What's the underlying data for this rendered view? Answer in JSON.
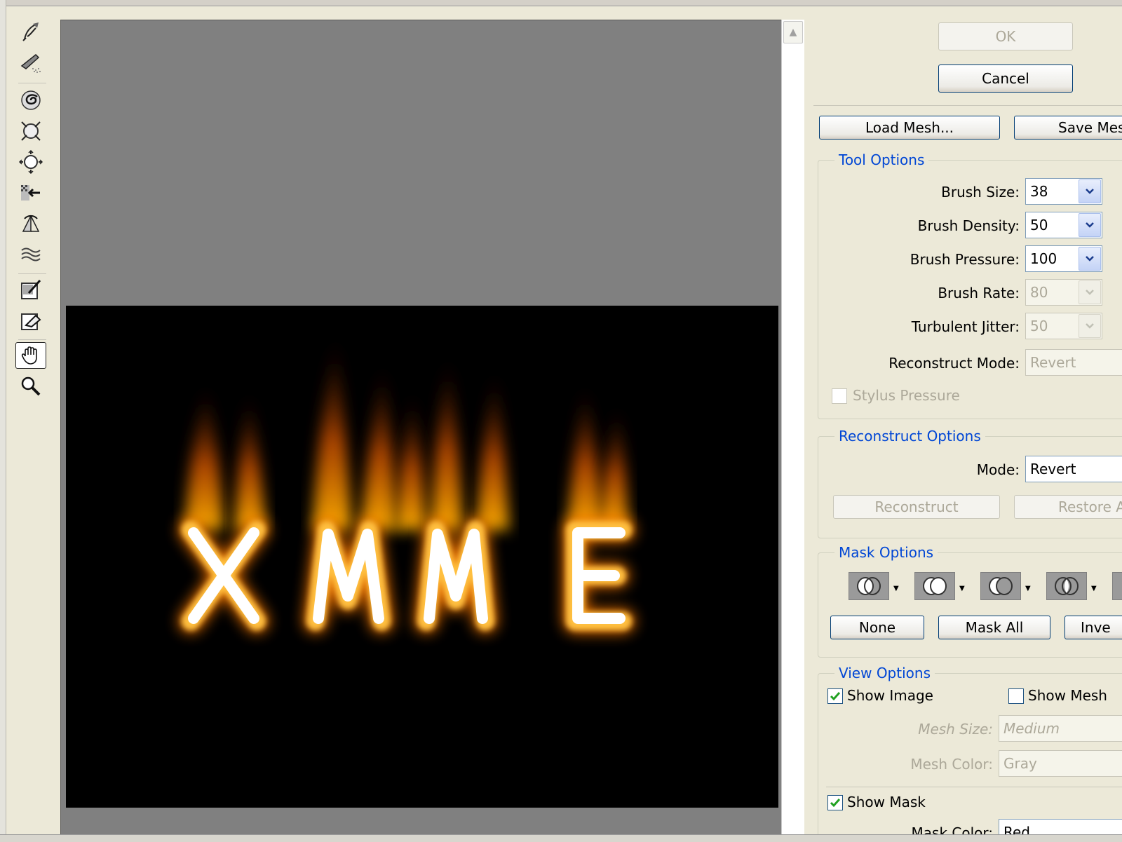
{
  "toolbar": {
    "tools": [
      {
        "name": "forward-warp-tool",
        "icon": "finger-warp-icon"
      },
      {
        "name": "reconstruct-tool",
        "icon": "reconstruct-brush-icon"
      },
      {
        "name": "twirl-tool",
        "icon": "twirl-icon"
      },
      {
        "name": "pucker-tool",
        "icon": "pucker-icon"
      },
      {
        "name": "bloat-tool",
        "icon": "bloat-icon"
      },
      {
        "name": "push-left-tool",
        "icon": "push-left-icon"
      },
      {
        "name": "mirror-tool",
        "icon": "mirror-icon"
      },
      {
        "name": "turbulence-tool",
        "icon": "turbulence-icon"
      },
      {
        "name": "freeze-mask-tool",
        "icon": "freeze-mask-icon"
      },
      {
        "name": "thaw-mask-tool",
        "icon": "thaw-mask-icon"
      },
      {
        "name": "hand-tool",
        "icon": "hand-icon",
        "active": true
      },
      {
        "name": "zoom-tool",
        "icon": "magnifier-icon"
      }
    ]
  },
  "canvas": {
    "fire_text": "XMME"
  },
  "buttons": {
    "ok": "OK",
    "cancel": "Cancel",
    "load_mesh": "Load Mesh...",
    "save_mesh": "Save Mes"
  },
  "tool_options": {
    "title": "Tool Options",
    "brush_size_label": "Brush Size:",
    "brush_size": "38",
    "brush_density_label": "Brush Density:",
    "brush_density": "50",
    "brush_pressure_label": "Brush Pressure:",
    "brush_pressure": "100",
    "brush_rate_label": "Brush Rate:",
    "brush_rate": "80",
    "turbulent_jitter_label": "Turbulent Jitter:",
    "turbulent_jitter": "50",
    "reconstruct_mode_label": "Reconstruct Mode:",
    "reconstruct_mode": "Revert",
    "stylus_pressure": "Stylus Pressure"
  },
  "reconstruct_options": {
    "title": "Reconstruct Options",
    "mode_label": "Mode:",
    "mode": "Revert",
    "reconstruct": "Reconstruct",
    "restore_all": "Restore A"
  },
  "mask_options": {
    "title": "Mask Options",
    "none": "None",
    "mask_all": "Mask All",
    "invert": "Inve"
  },
  "view_options": {
    "title": "View Options",
    "show_image": "Show Image",
    "show_image_checked": true,
    "show_mesh": "Show Mesh",
    "show_mesh_checked": false,
    "mesh_size_label": "Mesh Size:",
    "mesh_size": "Medium",
    "mesh_color_label": "Mesh Color:",
    "mesh_color": "Gray",
    "show_mask": "Show Mask",
    "show_mask_checked": true,
    "mask_color_label": "Mask Color:",
    "mask_color": "Red"
  },
  "colors": {
    "accent": "#0046d5",
    "fire_core": "#ffffff",
    "fire_mid": "#ff9a00",
    "fire_outer": "#c63a00"
  }
}
